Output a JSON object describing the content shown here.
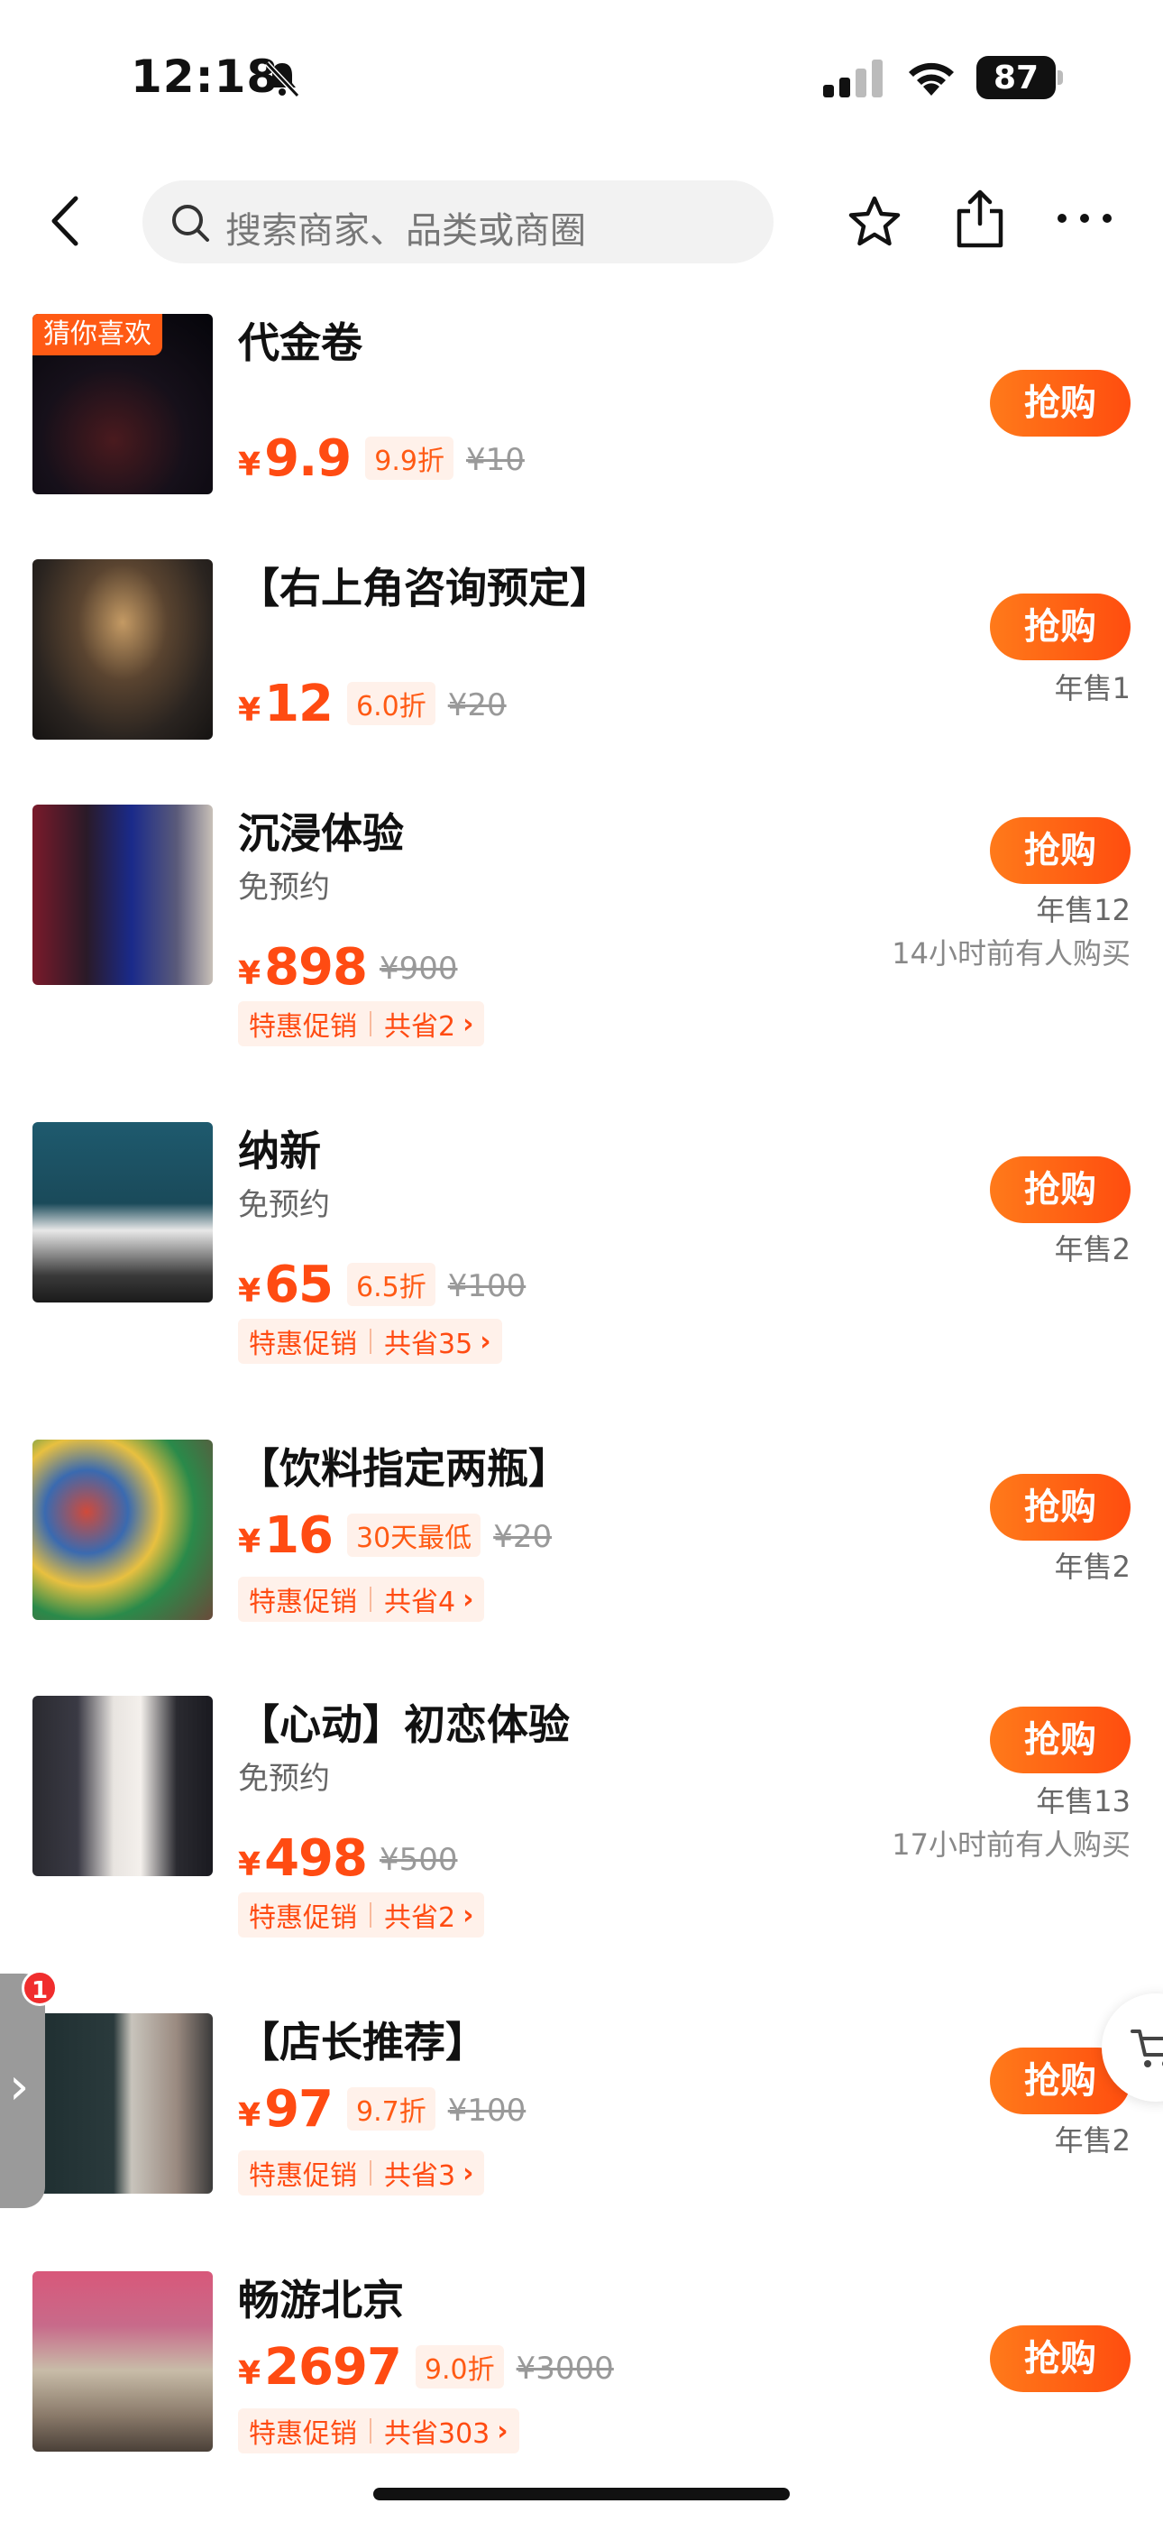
{
  "status_bar": {
    "time": "12:18",
    "battery": "87"
  },
  "search": {
    "placeholder": "搜索商家、品类或商圈"
  },
  "items": [
    {
      "tag": "猜你喜欢",
      "title": "代金卷",
      "subtitle": "",
      "price_symbol": "¥",
      "price": "9.9",
      "discount": "9.9折",
      "original": "¥10",
      "promo_label": "",
      "promo_saving": "",
      "buy_label": "抢购",
      "sold": "",
      "recent": ""
    },
    {
      "tag": "",
      "title": "【右上角咨询预定】",
      "subtitle": "",
      "price_symbol": "¥",
      "price": "12",
      "discount": "6.0折",
      "original": "¥20",
      "promo_label": "",
      "promo_saving": "",
      "buy_label": "抢购",
      "sold": "年售1",
      "recent": ""
    },
    {
      "tag": "",
      "title": "沉浸体验",
      "subtitle": "免预约",
      "price_symbol": "¥",
      "price": "898",
      "discount": "",
      "original": "¥900",
      "promo_label": "特惠促销",
      "promo_saving": "共省2",
      "buy_label": "抢购",
      "sold": "年售12",
      "recent": "14小时前有人购买"
    },
    {
      "tag": "",
      "title": "纳新",
      "subtitle": "免预约",
      "price_symbol": "¥",
      "price": "65",
      "discount": "6.5折",
      "original": "¥100",
      "promo_label": "特惠促销",
      "promo_saving": "共省35",
      "buy_label": "抢购",
      "sold": "年售2",
      "recent": ""
    },
    {
      "tag": "",
      "title": "【饮料指定两瓶】",
      "subtitle": "",
      "price_symbol": "¥",
      "price": "16",
      "discount": "30天最低",
      "original": "¥20",
      "promo_label": "特惠促销",
      "promo_saving": "共省4",
      "buy_label": "抢购",
      "sold": "年售2",
      "recent": ""
    },
    {
      "tag": "",
      "title": "【心动】初恋体验",
      "subtitle": "免预约",
      "price_symbol": "¥",
      "price": "498",
      "discount": "",
      "original": "¥500",
      "promo_label": "特惠促销",
      "promo_saving": "共省2",
      "buy_label": "抢购",
      "sold": "年售13",
      "recent": "17小时前有人购买"
    },
    {
      "tag": "",
      "title": "【店长推荐】",
      "subtitle": "",
      "price_symbol": "¥",
      "price": "97",
      "discount": "9.7折",
      "original": "¥100",
      "promo_label": "特惠促销",
      "promo_saving": "共省3",
      "buy_label": "抢购",
      "sold": "年售2",
      "recent": ""
    },
    {
      "tag": "",
      "title": "畅游北京",
      "subtitle": "",
      "price_symbol": "¥",
      "price": "2697",
      "discount": "9.0折",
      "original": "¥3000",
      "promo_label": "特惠促销",
      "promo_saving": "共省303",
      "buy_label": "抢购",
      "sold": "",
      "recent": ""
    }
  ],
  "side_badge": "1",
  "icons": {
    "back": "chevron-left-icon",
    "search": "search-icon",
    "favorite": "star-icon",
    "share": "share-icon",
    "more": "more-icon",
    "cart": "cart-icon"
  },
  "colors": {
    "accent": "#ff4b12",
    "button": "#ff6414",
    "promo_bg": "#fff1ea",
    "badge": "#f02d2d"
  }
}
